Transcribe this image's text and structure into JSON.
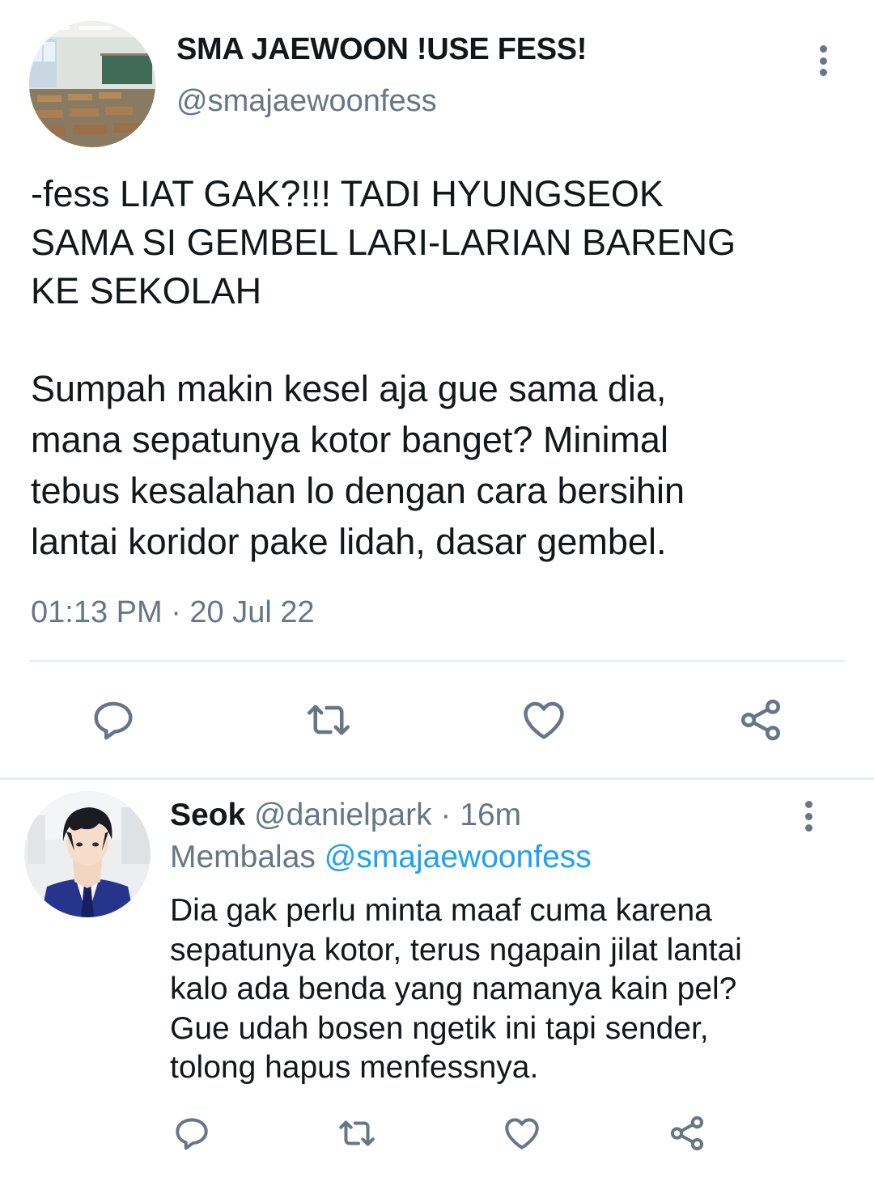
{
  "tweet": {
    "avatar": "classroom-photo",
    "display_name": "SMA JAEWOON !USE FESS!",
    "handle": "@smajaewoonfess",
    "text_paragraph_1": [
      "-fess LIAT GAK?!!! TADI HYUNGSEOK",
      "SAMA SI GEMBEL LARI-LARIAN BARENG",
      "KE SEKOLAH"
    ],
    "text_paragraph_2": [
      "Sumpah makin kesel aja gue sama dia,",
      "mana sepatunya kotor banget? Minimal",
      "tebus kesalahan lo dengan cara bersihin",
      "lantai koridor pake lidah, dasar gembel."
    ],
    "timestamp": "01:13 PM · 20 Jul 22",
    "actions": [
      "reply-icon",
      "retweet-icon",
      "like-icon",
      "share-icon"
    ]
  },
  "reply": {
    "avatar": "anime-character-portrait",
    "display_name": "Seok",
    "meta": " @danielpark · 16m",
    "replying_label": "Membalas ",
    "replying_to": "@smajaewoonfess",
    "text": [
      "Dia gak perlu minta maaf cuma karena",
      "sepatunya kotor, terus ngapain jilat lantai",
      "kalo ada benda yang namanya kain pel?",
      "Gue udah bosen ngetik ini tapi sender,",
      "tolong hapus menfessnya."
    ],
    "actions": [
      "reply-icon",
      "retweet-icon",
      "like-icon",
      "share-icon"
    ]
  },
  "colors": {
    "text": "#14171a",
    "secondary": "#657786",
    "link": "#1da1f2",
    "divider": "#e6ecf0"
  }
}
